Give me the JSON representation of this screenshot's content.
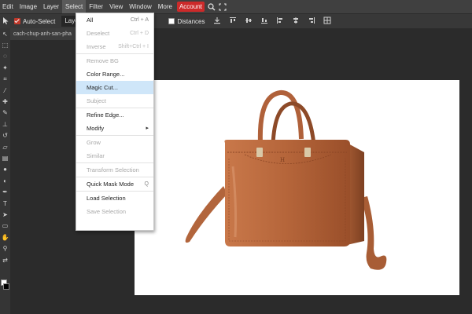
{
  "menubar": {
    "items": [
      "Edit",
      "Image",
      "Layer",
      "Select",
      "Filter",
      "View",
      "Window",
      "More",
      "Account"
    ],
    "active": "Select",
    "icons": [
      "search-icon",
      "fullscreen-icon"
    ]
  },
  "optionsbar": {
    "auto_select_label": "Auto-Select",
    "auto_select_checked": true,
    "layer_dropdown": "Layer",
    "distances_label": "Distances",
    "distances_checked": false
  },
  "document": {
    "tab_title": "cach-chup-anh-san-pha"
  },
  "select_menu": {
    "items": [
      {
        "label": "All",
        "shortcut": "Ctrl + A",
        "disabled": false
      },
      {
        "label": "Deselect",
        "shortcut": "Ctrl + D",
        "disabled": true
      },
      {
        "label": "Inverse",
        "shortcut": "Shift+Ctrl + I",
        "disabled": true
      },
      {
        "separator": true
      },
      {
        "label": "Remove BG",
        "shortcut": "",
        "disabled": true
      },
      {
        "label": "Color Range...",
        "shortcut": "",
        "disabled": false
      },
      {
        "label": "Magic Cut...",
        "shortcut": "",
        "disabled": false,
        "highlighted": true
      },
      {
        "label": "Subject",
        "shortcut": "",
        "disabled": true
      },
      {
        "separator": true
      },
      {
        "label": "Refine Edge...",
        "shortcut": "",
        "disabled": false
      },
      {
        "label": "Modify",
        "shortcut": "",
        "disabled": false,
        "submenu": true
      },
      {
        "separator": true
      },
      {
        "label": "Grow",
        "shortcut": "",
        "disabled": true
      },
      {
        "label": "Similar",
        "shortcut": "",
        "disabled": true
      },
      {
        "separator": true
      },
      {
        "label": "Transform Selection",
        "shortcut": "",
        "disabled": true
      },
      {
        "separator": true
      },
      {
        "label": "Quick Mask Mode",
        "shortcut": "Q",
        "disabled": false
      },
      {
        "separator": true
      },
      {
        "label": "Load Selection",
        "shortcut": "",
        "disabled": false
      },
      {
        "label": "Save Selection",
        "shortcut": "",
        "disabled": true
      }
    ]
  },
  "colors": {
    "accent": "#cc2a2a",
    "highlight": "#cfe6f9",
    "bag": "#b5653a"
  },
  "canvas_image": "brown leather handbag photo"
}
